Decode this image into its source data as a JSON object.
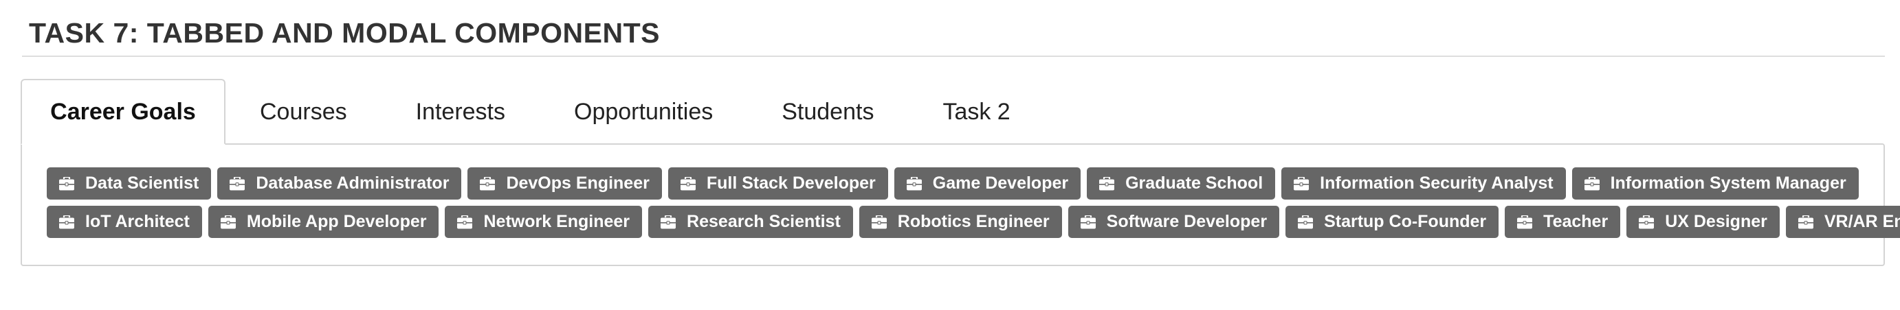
{
  "header": {
    "title": "TASK 7: TABBED AND MODAL COMPONENTS"
  },
  "tabs": [
    {
      "label": "Career Goals",
      "active": true
    },
    {
      "label": "Courses",
      "active": false
    },
    {
      "label": "Interests",
      "active": false
    },
    {
      "label": "Opportunities",
      "active": false
    },
    {
      "label": "Students",
      "active": false
    },
    {
      "label": "Task 2",
      "active": false
    }
  ],
  "career_goals": {
    "badge_icon": "briefcase-icon",
    "badge_color": "#666666",
    "rows": [
      [
        "Data Scientist",
        "Database Administrator",
        "DevOps Engineer",
        "Full Stack Developer",
        "Game Developer",
        "Graduate School",
        "Information Security Analyst",
        "Information System Manager"
      ],
      [
        "IoT Architect",
        "Mobile App Developer",
        "Network Engineer",
        "Research Scientist",
        "Robotics Engineer",
        "Software Developer",
        "Startup Co-Founder",
        "Teacher",
        "UX Designer",
        "VR/AR Engineer"
      ]
    ]
  }
}
